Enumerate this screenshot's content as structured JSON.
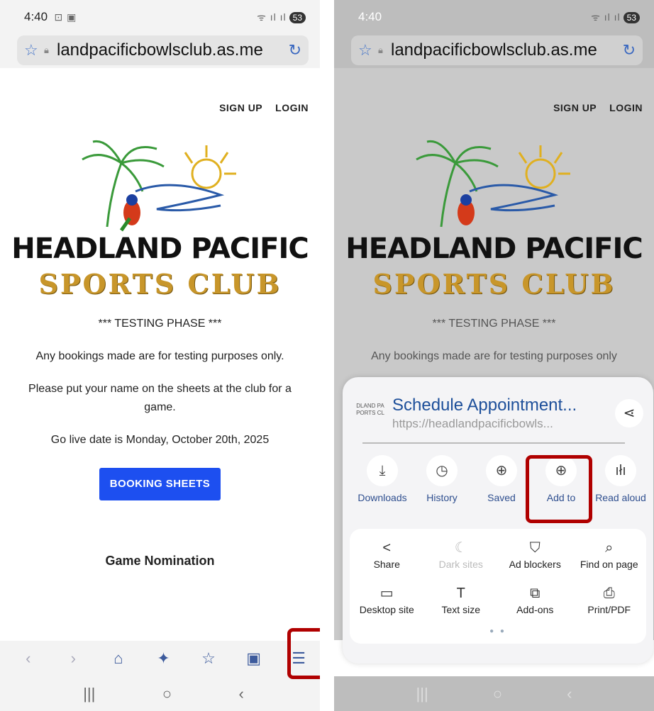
{
  "status": {
    "time": "4:40",
    "left_icons": "⊡ ▣",
    "signal": "ᯤ ıl ıl",
    "battery": "53"
  },
  "browser": {
    "url": "landpacificbowlsclub.as.me"
  },
  "site": {
    "nav": {
      "signup": "SIGN UP",
      "login": "LOGIN"
    },
    "logo_line1": "HEADLAND PACIFIC",
    "logo_line2": "SPORTS CLUB",
    "testing": "*** TESTING PHASE ***",
    "bookings_note": "Any bookings made are for testing purposes only.",
    "sheets_note": "Please put your name on the sheets at the club for a game.",
    "golive": "Go live date is Monday, October 20th, 2025",
    "booking_button": "BOOKING SHEETS",
    "game_nomination": "Game Nomination",
    "cutoff_text": "Any bookings made are for testing purposes only"
  },
  "toolbar": {
    "back": "‹",
    "forward": "›",
    "home": "⌂",
    "ai": "✦",
    "bookmarks": "☆",
    "tabs": "▣",
    "menu": "☰"
  },
  "navbar": {
    "recents": "|||",
    "home": "○",
    "back": "‹"
  },
  "menu_sheet": {
    "title": "Schedule Appointment...",
    "url": "https://headlandpacificbowls...",
    "thumb_text": "DLAND PA PORTS CL",
    "quick": [
      {
        "label": "Downloads",
        "icon": "⤓"
      },
      {
        "label": "History",
        "icon": "◷"
      },
      {
        "label": "Saved",
        "icon": "⊕"
      },
      {
        "label": "Add to",
        "icon": "⊕"
      },
      {
        "label": "Read aloud",
        "icon": "ıłı"
      }
    ],
    "grid": [
      {
        "label": "Share",
        "icon": "<"
      },
      {
        "label": "Dark sites",
        "icon": "☾"
      },
      {
        "label": "Ad blockers",
        "icon": "⛉"
      },
      {
        "label": "Find on page",
        "icon": "⌕"
      },
      {
        "label": "Desktop site",
        "icon": "▭"
      },
      {
        "label": "Text size",
        "icon": "T"
      },
      {
        "label": "Add-ons",
        "icon": "⧉"
      },
      {
        "label": "Print/PDF",
        "icon": "⎙"
      }
    ]
  },
  "colors": {
    "accent": "#1d4ff0",
    "highlight": "#b00000",
    "link": "#1d4f9a"
  }
}
